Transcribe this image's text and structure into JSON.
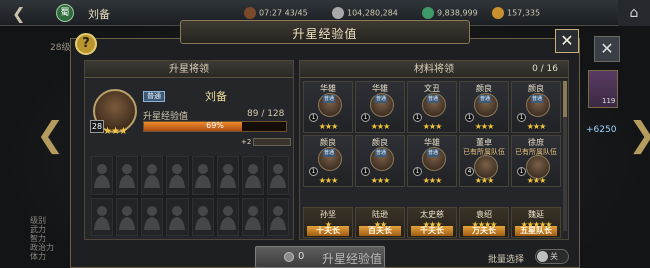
{
  "topbar": {
    "faction": "蜀",
    "hero_name": "刘备",
    "time_stamina": "07:27 43/45",
    "silver": "104,280,284",
    "jade": "9,838,999",
    "gold": "157,335"
  },
  "background": {
    "left_level": "28级",
    "left_stats": [
      "级别",
      "武力",
      "智力",
      "政治力",
      "体力"
    ],
    "right_count": "119",
    "right_plus": "+6250"
  },
  "modal": {
    "title": "升星经验值",
    "help": "?",
    "close": "✕",
    "left_panel": {
      "header": "升星将领",
      "hero": {
        "name": "刘备",
        "badge": "普通",
        "level": "28",
        "stars": "★★★",
        "exp_label": "升星经验值",
        "exp_value": "89 / 128",
        "exp_percent": 69,
        "exp_pct_text": "69%",
        "exp_gain": "+2"
      }
    },
    "right_panel": {
      "header": "材料将领",
      "count": "0 / 16",
      "cards": [
        {
          "name": "华雄",
          "badge": "普通",
          "level": "1",
          "stars": "★★★",
          "tag": ""
        },
        {
          "name": "华雄",
          "badge": "普通",
          "level": "1",
          "stars": "★★★",
          "tag": ""
        },
        {
          "name": "文丑",
          "badge": "普通",
          "level": "1",
          "stars": "★★★",
          "tag": ""
        },
        {
          "name": "颜良",
          "badge": "普通",
          "level": "1",
          "stars": "★★★",
          "tag": ""
        },
        {
          "name": "颜良",
          "badge": "普通",
          "level": "1",
          "stars": "★★★",
          "tag": ""
        },
        {
          "name": "颜良",
          "badge": "普通",
          "level": "1",
          "stars": "★★★",
          "tag": ""
        },
        {
          "name": "颜良",
          "badge": "普通",
          "level": "1",
          "stars": "★★★",
          "tag": ""
        },
        {
          "name": "华雄",
          "badge": "普通",
          "level": "1",
          "stars": "★★★",
          "tag": ""
        },
        {
          "name": "董卓",
          "badge": "",
          "level": "4",
          "stars": "★★★",
          "tag": "已有所属队伍"
        },
        {
          "name": "徐庶",
          "badge": "",
          "level": "1",
          "stars": "★★★",
          "tag": "已有所属队伍"
        }
      ],
      "ranks": [
        {
          "name": "孙坚",
          "stars": "★",
          "title": "十夫长"
        },
        {
          "name": "陆逊",
          "stars": "★★",
          "title": "百夫长"
        },
        {
          "name": "太史慈",
          "stars": "★★★",
          "title": "千夫长"
        },
        {
          "name": "袁绍",
          "stars": "★★★★",
          "title": "万夫长"
        },
        {
          "name": "魏延",
          "stars": "★★★★★",
          "title": "五星队长"
        }
      ]
    },
    "upgrade_cost": "0",
    "upgrade_label": "升星经验值",
    "batch_label": "批量选择",
    "toggle_label": "关"
  }
}
